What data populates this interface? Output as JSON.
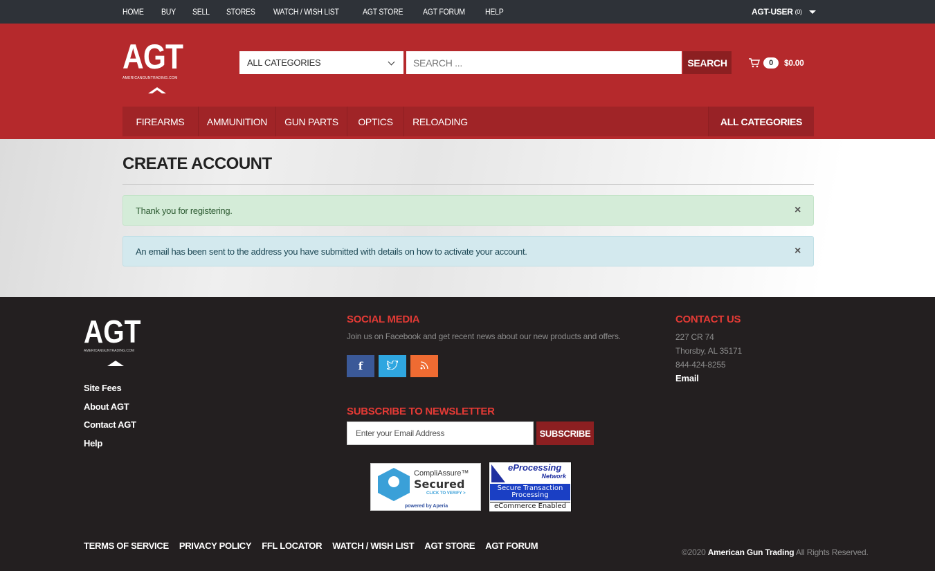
{
  "topbar": {
    "links": [
      "HOME",
      "BUY",
      "SELL",
      "STORES",
      "WATCH / WISH LIST",
      "AGT STORE",
      "AGT FORUM",
      "HELP"
    ],
    "user": "AGT-USER",
    "user_count": "(0)"
  },
  "header": {
    "logo_text": "AGT",
    "logo_sub": "AMERICANGUNTRADING.COM",
    "category_select": "ALL CATEGORIES",
    "search_placeholder": "SEARCH ...",
    "search_button": "SEARCH",
    "cart_count": "0",
    "cart_total": "$0.00"
  },
  "mainnav": {
    "items": [
      "FIREARMS",
      "AMMUNITION",
      "GUN PARTS",
      "OPTICS",
      "RELOADING"
    ],
    "all_categories": "ALL CATEGORIES"
  },
  "content": {
    "title": "CREATE ACCOUNT",
    "alerts": [
      {
        "type": "success",
        "text": "Thank you for registering.",
        "close": "×"
      },
      {
        "type": "info",
        "text": "An email has been sent to the address you have submitted with details on how to activate your account.",
        "close": "×"
      }
    ]
  },
  "footer": {
    "logo_text": "AGT",
    "logo_sub": "AMERICANGUNTRADING.COM",
    "links": [
      "Site Fees",
      "About AGT",
      "Contact AGT",
      "Help"
    ],
    "social_title": "SOCIAL MEDIA",
    "social_text": "Join us on Facebook and get recent news about our new products and offers.",
    "social_icons": [
      "facebook-icon",
      "twitter-icon",
      "rss-icon"
    ],
    "newsletter_title": "SUBSCRIBE TO NEWSLETTER",
    "email_placeholder": "Enter your Email Address",
    "subscribe_button": "SUBSCRIBE",
    "badge_compliassure": {
      "line1": "CompliAssure™",
      "line2": "Secured",
      "line3": "CLICK TO VERIFY >",
      "line4": "powered by Aperia"
    },
    "badge_eprocessing": {
      "line1": "eProcessing",
      "line2": "Network",
      "line3": "Secure Transaction Processing",
      "line4": "eCommerce Enabled"
    },
    "contact_title": "CONTACT US",
    "address1": "227 CR 74",
    "address2": "Thorsby, AL 35171",
    "phone": "844-424-8255",
    "email": "Email",
    "bottom_links": [
      "TERMS OF SERVICE",
      "PRIVACY POLICY",
      "FFL LOCATOR",
      "WATCH / WISH LIST",
      "AGT STORE",
      "AGT FORUM"
    ],
    "copyright_prefix": "©2020",
    "copyright_brand": "American Gun Trading",
    "copyright_suffix": "All Rights Reserved."
  },
  "colors": {
    "header_red": "#b5292c",
    "topbar": "#2e3238",
    "footer": "#231f20",
    "accent_red": "#e33a35",
    "button_dark_red": "#8c1f21"
  }
}
